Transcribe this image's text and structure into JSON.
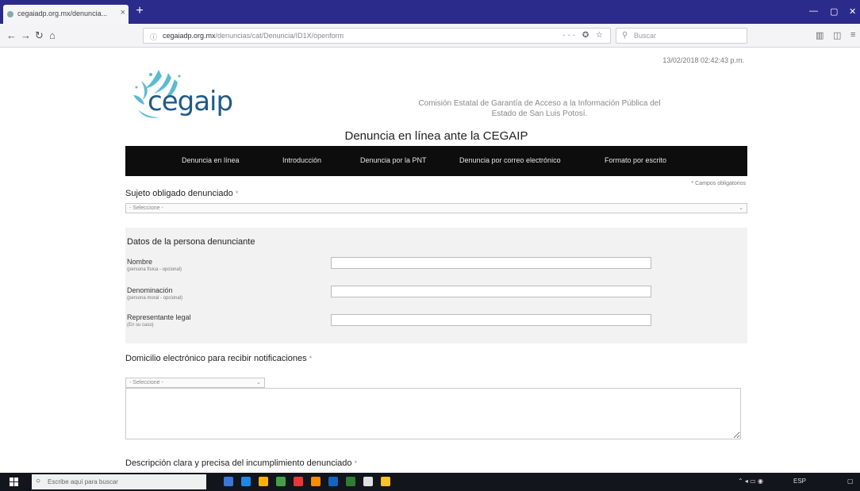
{
  "browser": {
    "tab_title": "cegaiadp.org.mx/denuncia...",
    "tab_close": "×",
    "new_tab": "+",
    "url_host": "cegaiadp.org.mx",
    "url_path": "/denuncias/cat/Denuncia/ID1X/openform",
    "search_placeholder": "Buscar",
    "url_icons": "··· ✪ ☆"
  },
  "page": {
    "timestamp": "13/02/2018 02:42:43 p.m.",
    "logo_text": "cegaip",
    "org_name_line1": "Comisión Estatal de Garantía de Acceso a la Información Pública del",
    "org_name_line2": "Estado de San Luis Potosí.",
    "title": "Denuncia en línea ante la CEGAIP",
    "menu": [
      "Denuncia en línea",
      "Introducción",
      "Denuncia por la PNT",
      "Denuncia por correo electrónico",
      "Formato por escrito"
    ],
    "required_note": "* Campos obligatorios",
    "subject_label": "Sujeto obligado denunciado",
    "required_mark": "*",
    "select_placeholder": "- Seleccione -",
    "person_section_title": "Datos de la persona denunciante",
    "fields": [
      {
        "label": "Nombre",
        "hint": "(persona física - opcional)"
      },
      {
        "label": "Denominación",
        "hint": "(persona moral - opcional)"
      },
      {
        "label": "Representante legal",
        "hint": "(En su caso)"
      }
    ],
    "notification_label": "Domicilio electrónico para recibir notificaciones",
    "description_label": "Descripción clara y precisa del incumplimiento denunciado"
  },
  "taskbar": {
    "search_placeholder": "Escribe aquí para buscar",
    "tray_text": "ESP",
    "app_colors": [
      "#3a78d8",
      "#1e88e5",
      "#ffb300",
      "#43a047",
      "#e53935",
      "#fb8c00",
      "#1565c0",
      "#2e7d32",
      "#e0e0e0",
      "#fbc02d"
    ]
  }
}
